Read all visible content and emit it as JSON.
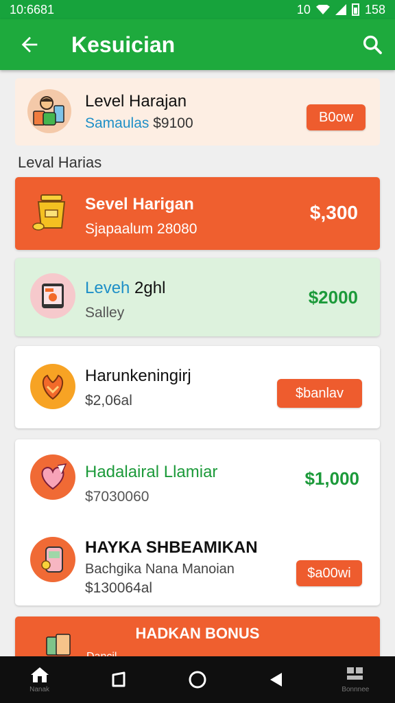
{
  "status": {
    "time": "10:6681",
    "notif": "10",
    "battery": "158"
  },
  "app_bar": {
    "title": "Kesuician",
    "back_icon": "arrow-left-icon",
    "search_icon": "search-icon"
  },
  "colors": {
    "primary": "#1eaa3d",
    "accent": "#ee5c2e",
    "price_green": "#1c9a3a",
    "link_blue": "#1e8fc7"
  },
  "top_card": {
    "title": "Level Harajan",
    "subtitle_blue": "Samaulas",
    "subtitle_price": "$9100",
    "button": "B0ow",
    "icon": "person-with-cards-icon"
  },
  "section_label": "Leval Harias",
  "cards": [
    {
      "title": "Sevel Harigan",
      "subtitle": "Sjapaalum 28080",
      "price": "$,300",
      "icon": "gold-jar-icon"
    },
    {
      "title_colored": "Leveh",
      "title_rest": " 2ghl",
      "subtitle": "Salley",
      "price": "$2000",
      "icon": "tablet-icon"
    },
    {
      "title": "Harunkeningirj",
      "subtitle": "$2,06al",
      "button": "$banlav",
      "icon": "fruit-icon"
    },
    {
      "title": "Hadalairal Llamiar",
      "subtitle": "$7030060",
      "price": "$1,000",
      "icon": "heart-ribbon-icon"
    },
    {
      "title": "HAYKA SHBEAMIKAN",
      "subtitle": "Bachgika Nana Manoian",
      "subtitle2": "$130064al",
      "button": "$a00wi",
      "icon": "phone-flower-icon"
    }
  ],
  "bonus": {
    "title": "HADKAN BONUS",
    "peek": "Dancil"
  },
  "nav": {
    "home_label": "Nanak",
    "menu_label": "Bonnnee"
  }
}
